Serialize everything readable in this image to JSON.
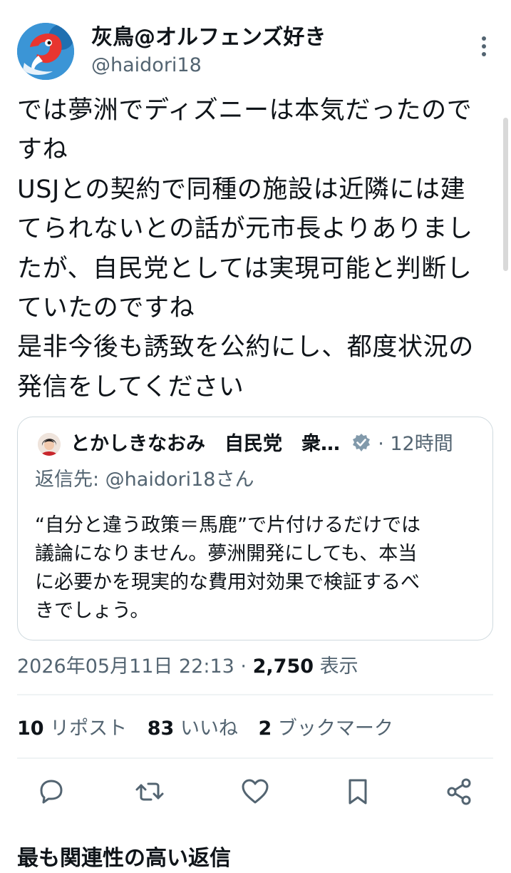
{
  "author": {
    "display_name": "灰鳥@オルフェンズ好き",
    "handle": "@haidori18"
  },
  "tweet": {
    "lines": [
      "では夢洲でディズニーは本気だったので",
      "すね",
      "USJとの契約で同種の施設は近隣には建",
      "てられないとの話が元市長よりありまし",
      "たが、自民党としては実現可能と判断し",
      "ていたのですね",
      "是非今後も誘致を公約にし、都度状況の",
      "発信をしてください"
    ]
  },
  "quoted_tweet": {
    "name": "とかしきなおみ　自民党　衆…",
    "time": "· 12時間",
    "reply_to": "返信先: @haidori18さん",
    "lines": [
      "“自分と違う政策＝馬鹿”で片付けるだけでは",
      "議論になりません。夢洲開発にしても、本当",
      "に必要かを現実的な費用対効果で検証するべ",
      "きでしょう。"
    ]
  },
  "meta": {
    "datetime": "2026年05月11日 22:13",
    "separator": "·",
    "views": "2,750",
    "views_label": "表示"
  },
  "stats": {
    "reposts_count": "10",
    "reposts_label": "リポスト",
    "likes_count": "83",
    "likes_label": "いいね",
    "bookmarks_count": "2",
    "bookmarks_label": "ブックマーク"
  },
  "actions": [
    "reply-icon",
    "repost-icon",
    "like-icon",
    "bookmark-icon",
    "share-icon"
  ],
  "section_heading": "最も関連性の高い返信",
  "colors": {
    "text": "#0f1419",
    "secondary": "#536471",
    "border": "#cfd9de",
    "divider": "#eff3f4"
  }
}
